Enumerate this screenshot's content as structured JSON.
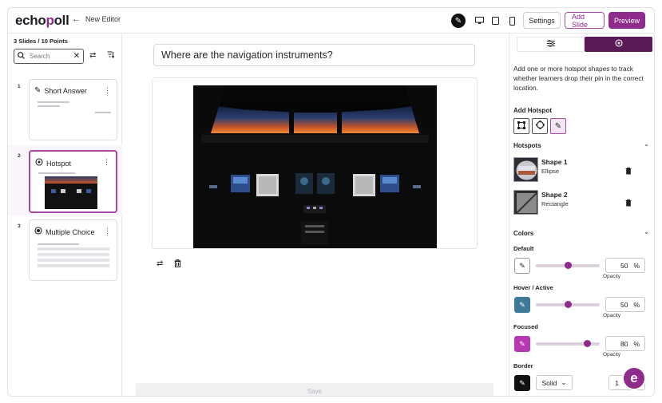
{
  "app": {
    "logo_left": "echo",
    "logo_o": "p",
    "logo_right": "oll",
    "editor_title": "New Editor"
  },
  "toolbar": {
    "settings_label": "Settings",
    "add_slide_label": "Add Slide",
    "preview_label": "Preview",
    "accent": "#8e2b8b"
  },
  "sidebar": {
    "count": "3 Slides / 10 Points",
    "search_placeholder": "Search",
    "slides": [
      {
        "num": "1",
        "title": "Short Answer",
        "icon": "edit-icon"
      },
      {
        "num": "2",
        "title": "Hotspot",
        "icon": "hotspot-icon"
      },
      {
        "num": "3",
        "title": "Multiple Choice",
        "icon": "radio-icon"
      }
    ]
  },
  "main": {
    "question": "Where are the navigation instruments?",
    "save_label": "Save"
  },
  "panel": {
    "description": "Add one or more hotspot shapes to track whether learners drop their pin in the correct location.",
    "add_hotspot_label": "Add Hotspot",
    "hotspots_label": "Hotspots",
    "hotspots": [
      {
        "name": "Shape 1",
        "type": "Ellipse"
      },
      {
        "name": "Shape 2",
        "type": "Rectangle"
      }
    ],
    "colors_label": "Colors",
    "colors": [
      {
        "label": "Default",
        "value": "50",
        "unit": "%",
        "opacity_label": "Opacity",
        "fraction": 0.5,
        "swatch": "#ffffff"
      },
      {
        "label": "Hover / Active",
        "value": "50",
        "unit": "%",
        "opacity_label": "Opacity",
        "fraction": 0.5,
        "swatch": "#3c7a98"
      },
      {
        "label": "Focused",
        "value": "80",
        "unit": "%",
        "opacity_label": "Opacity",
        "fraction": 0.8,
        "swatch": "#b53ab1"
      }
    ],
    "border_label": "Border",
    "border_style": "Solid",
    "border_width": "1"
  }
}
